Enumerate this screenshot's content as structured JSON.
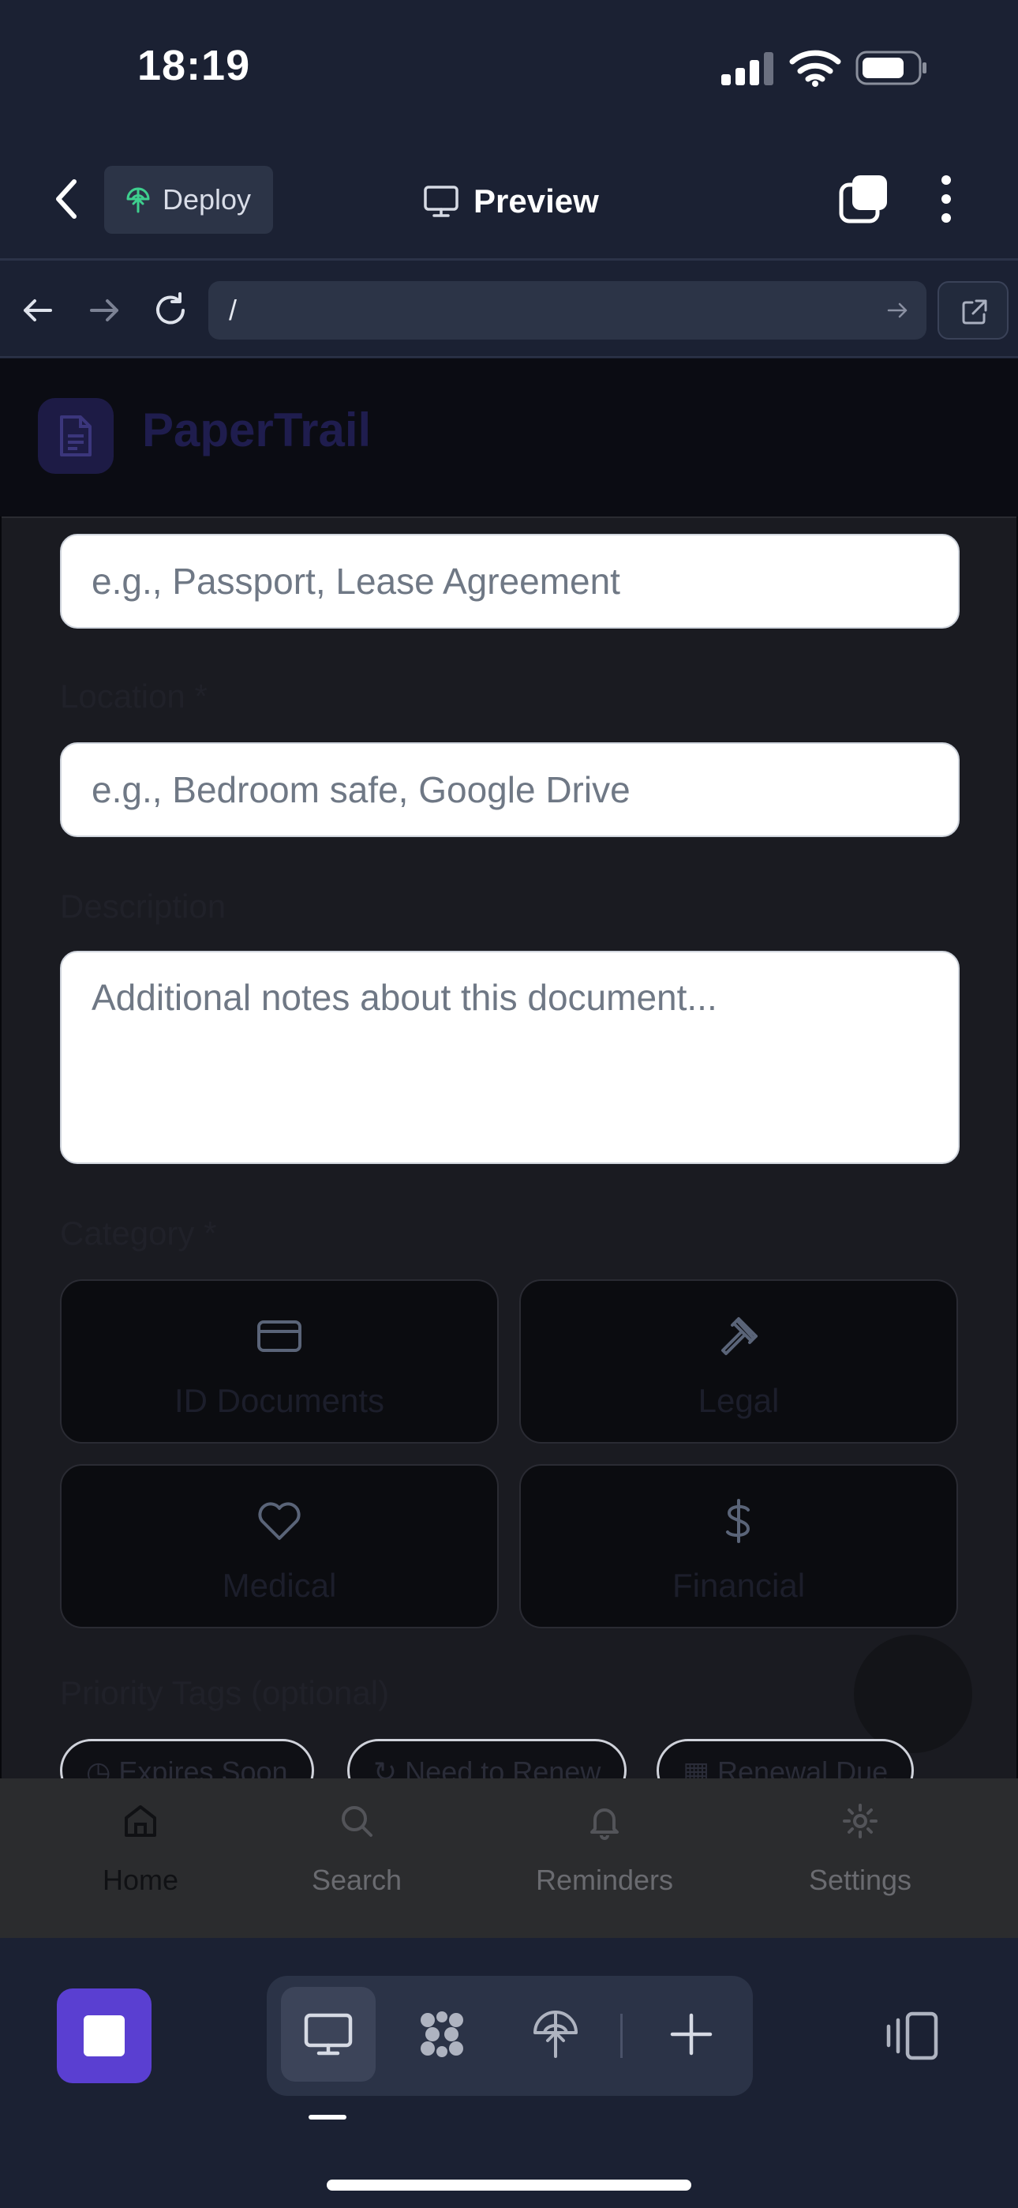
{
  "status_bar": {
    "time": "18:19"
  },
  "toolbar": {
    "deploy_label": "Deploy",
    "preview_label": "Preview"
  },
  "browser": {
    "url": "/"
  },
  "site": {
    "name": "PaperTrail"
  },
  "form": {
    "name_placeholder": "e.g., Passport, Lease Agreement",
    "location_label": "Location *",
    "location_placeholder": "e.g., Bedroom safe, Google Drive",
    "description_label": "Description",
    "description_placeholder": "Additional notes about this document...",
    "category_label": "Category *",
    "categories": [
      {
        "label": "ID Documents",
        "icon": "credit-card-icon"
      },
      {
        "label": "Legal",
        "icon": "gavel-icon"
      },
      {
        "label": "Medical",
        "icon": "heart-icon"
      },
      {
        "label": "Financial",
        "icon": "dollar-icon"
      }
    ],
    "priority_label": "Priority Tags (optional)",
    "tags": [
      {
        "label": "Expires Soon",
        "icon": "clock-icon"
      },
      {
        "label": "Need to Renew",
        "icon": "refresh-icon"
      },
      {
        "label": "Renewal Due",
        "icon": "calendar-icon"
      }
    ]
  },
  "bottom_nav": {
    "items": [
      {
        "label": "Home",
        "icon": "home-icon"
      },
      {
        "label": "Search",
        "icon": "search-icon"
      },
      {
        "label": "Reminders",
        "icon": "bell-icon"
      },
      {
        "label": "Settings",
        "icon": "gear-icon"
      }
    ]
  },
  "dock": {
    "tools": [
      "desktop-icon",
      "grid-icon",
      "deploy-icon",
      "plus-icon"
    ]
  },
  "colors": {
    "accent": "#5a3fd1",
    "background": "#1b2133",
    "deploy_green": "#3ecf8e"
  }
}
